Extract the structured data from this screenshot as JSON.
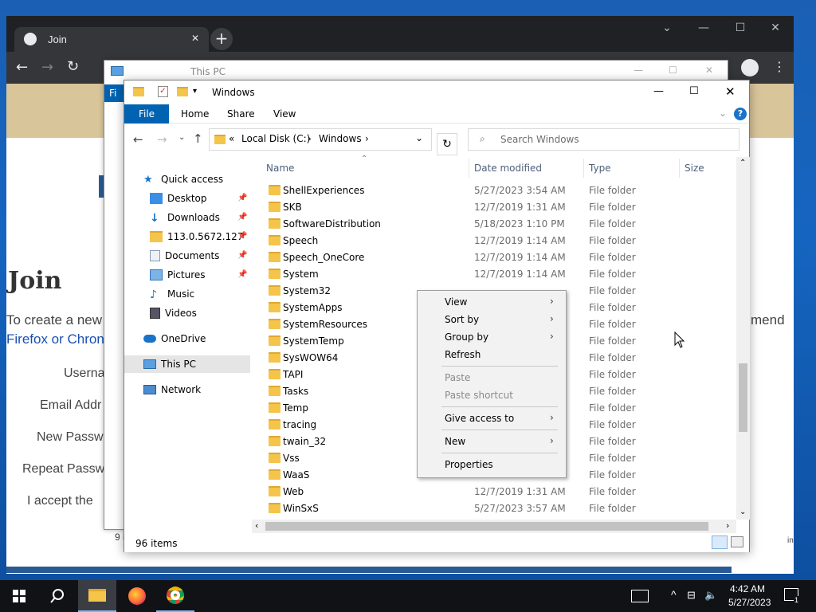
{
  "browser": {
    "tab_title": "Join",
    "tab_close": "✕",
    "new_tab": "+",
    "controls": {
      "dropdown": "⌄",
      "minimize": "—",
      "maximize": "☐",
      "close": "✕"
    }
  },
  "website": {
    "heading": "Join",
    "intro_text": "To create a new",
    "intro_tail": "mend",
    "link_text": "Firefox or Chron",
    "fields": [
      "Userna",
      "Email Addr",
      "New Passw",
      "Repeat Passw",
      "I accept the "
    ],
    "side_fragment_1": "9 i",
    "side_fragment_2": "in"
  },
  "explorer_bg": {
    "title": "This PC",
    "ribbon_fragment": "Fi"
  },
  "explorer": {
    "title": "Windows",
    "ribbon_tabs": [
      "File",
      "Home",
      "Share",
      "View"
    ],
    "address": {
      "prefix": "«",
      "segments": [
        "Local Disk (C:)",
        "Windows"
      ]
    },
    "search_placeholder": "Search Windows",
    "columns": [
      "Name",
      "Date modified",
      "Type",
      "Size"
    ],
    "nav": [
      {
        "label": "Quick access",
        "pinned": false
      },
      {
        "label": "Desktop",
        "pinned": true
      },
      {
        "label": "Downloads",
        "pinned": true
      },
      {
        "label": "113.0.5672.127",
        "pinned": true
      },
      {
        "label": "Documents",
        "pinned": true
      },
      {
        "label": "Pictures",
        "pinned": true
      },
      {
        "label": "Music",
        "pinned": false
      },
      {
        "label": "Videos",
        "pinned": false
      },
      {
        "label": "OneDrive",
        "pinned": false
      },
      {
        "label": "This PC",
        "pinned": false
      },
      {
        "label": "Network",
        "pinned": false
      }
    ],
    "rows": [
      {
        "name": "ShellExperiences",
        "date": "5/27/2023 3:54 AM",
        "type": "File folder"
      },
      {
        "name": "SKB",
        "date": "12/7/2019 1:31 AM",
        "type": "File folder"
      },
      {
        "name": "SoftwareDistribution",
        "date": "5/18/2023 1:10 PM",
        "type": "File folder"
      },
      {
        "name": "Speech",
        "date": "12/7/2019 1:14 AM",
        "type": "File folder"
      },
      {
        "name": "Speech_OneCore",
        "date": "12/7/2019 1:14 AM",
        "type": "File folder"
      },
      {
        "name": "System",
        "date": "12/7/2019 1:14 AM",
        "type": "File folder"
      },
      {
        "name": "System32",
        "date": "",
        "type": "File folder"
      },
      {
        "name": "SystemApps",
        "date": "",
        "type": "File folder"
      },
      {
        "name": "SystemResources",
        "date": "",
        "type": "File folder"
      },
      {
        "name": "SystemTemp",
        "date": "",
        "type": "File folder"
      },
      {
        "name": "SysWOW64",
        "date": "",
        "type": "File folder"
      },
      {
        "name": "TAPI",
        "date": "",
        "type": "File folder"
      },
      {
        "name": "Tasks",
        "date": "",
        "type": "File folder"
      },
      {
        "name": "Temp",
        "date": "",
        "type": "File folder"
      },
      {
        "name": "tracing",
        "date": "",
        "type": "File folder"
      },
      {
        "name": "twain_32",
        "date": "",
        "type": "File folder"
      },
      {
        "name": "Vss",
        "date": "",
        "type": "File folder"
      },
      {
        "name": "WaaS",
        "date": "",
        "type": "File folder"
      },
      {
        "name": "Web",
        "date": "12/7/2019 1:31 AM",
        "type": "File folder"
      },
      {
        "name": "WinSxS",
        "date": "5/27/2023 3:57 AM",
        "type": "File folder"
      }
    ],
    "status": "96 items"
  },
  "context_menu": {
    "items": [
      {
        "label": "View",
        "submenu": true,
        "disabled": false
      },
      {
        "label": "Sort by",
        "submenu": true,
        "disabled": false
      },
      {
        "label": "Group by",
        "submenu": true,
        "disabled": false
      },
      {
        "label": "Refresh",
        "submenu": false,
        "disabled": false
      },
      {
        "label": "Paste",
        "submenu": false,
        "disabled": true
      },
      {
        "label": "Paste shortcut",
        "submenu": false,
        "disabled": true
      },
      {
        "label": "Give access to",
        "submenu": true,
        "disabled": false
      },
      {
        "label": "New",
        "submenu": true,
        "disabled": false
      },
      {
        "label": "Properties",
        "submenu": false,
        "disabled": false
      }
    ]
  },
  "taskbar": {
    "time": "4:42 AM",
    "date": "5/27/2023",
    "notification_count": "1"
  },
  "colors": {
    "accent": "#0063b1",
    "folder": "#f4c54a",
    "taskbar": "#101216",
    "chrome_dark": "#202124"
  },
  "icons": [
    "search-icon",
    "back-arrow-icon",
    "forward-arrow-icon",
    "up-arrow-icon",
    "refresh-icon",
    "folder-icon",
    "pin-icon",
    "help-icon",
    "chevron-right-icon",
    "windows-start-icon",
    "file-explorer-icon",
    "firefox-icon",
    "chrome-icon",
    "speaker-muted-icon",
    "network-icon",
    "notification-icon"
  ]
}
